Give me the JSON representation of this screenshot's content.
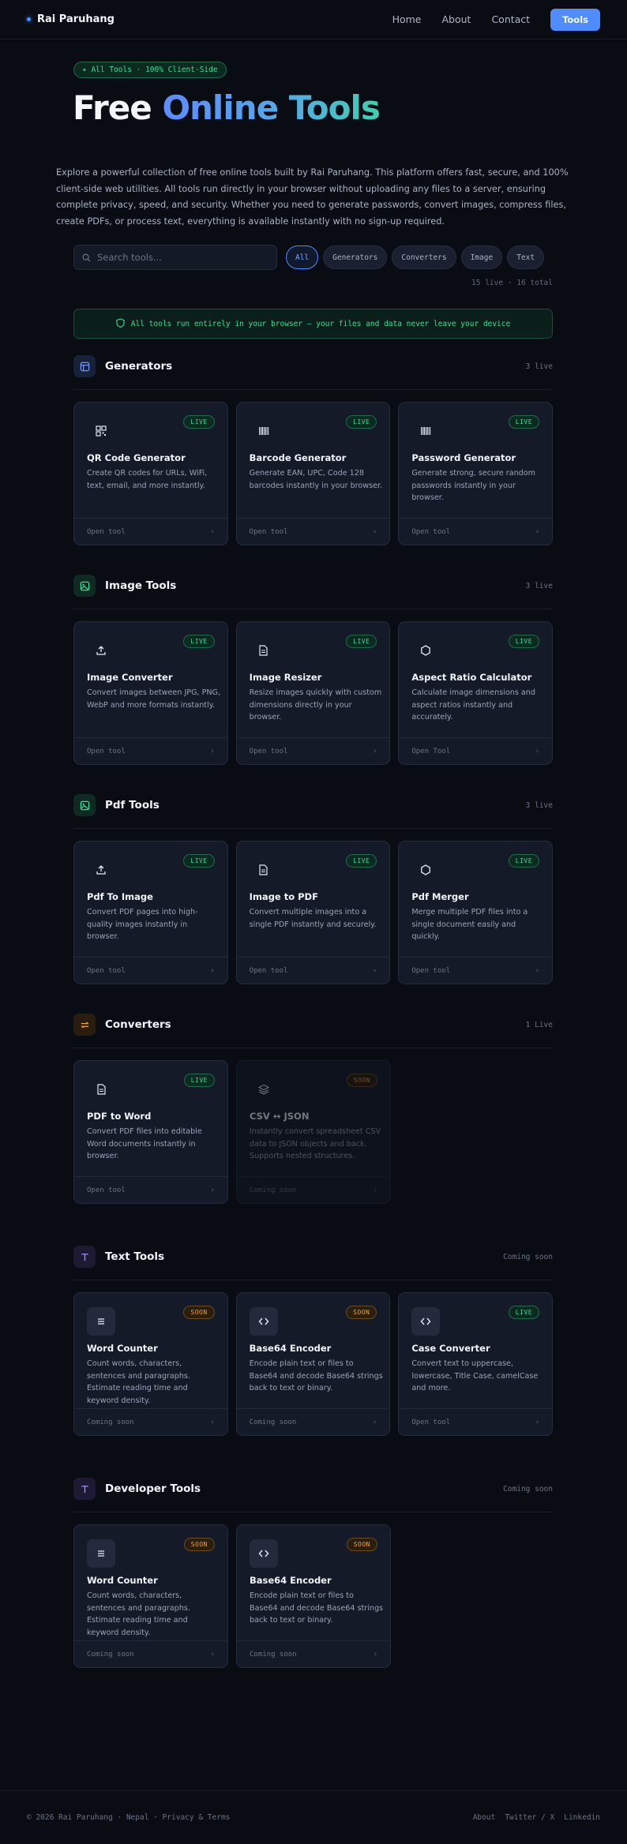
{
  "nav": {
    "brand": "Rai Paruhang",
    "links": [
      "Home",
      "About",
      "Contact"
    ],
    "cta": "Tools"
  },
  "hero": {
    "badge": "✦ All Tools · 100% Client-Side",
    "title_part1": "Free",
    "title_part2": "Online Tools",
    "description": "Explore a powerful collection of free online tools built by Rai Paruhang. This platform offers fast, secure, and 100% client-side web utilities. All tools run directly in your browser without uploading any files to a server, ensuring complete privacy, speed, and security. Whether you need to generate passwords, convert images, compress files, create PDFs, or process text, everything is available instantly with no sign-up required."
  },
  "search": {
    "placeholder": "Search tools..."
  },
  "filters": [
    "All",
    "Generators",
    "Converters",
    "Image",
    "Text"
  ],
  "counts": "15 live · 16 total",
  "notice": "All tools run entirely in your browser — your files and data never leave your device",
  "colors": {
    "accent": "#4f8cff",
    "live": "#3ddc97",
    "soon": "#f0a040"
  },
  "sections": [
    {
      "title": "Generators",
      "count": "3 live",
      "icon": "layout-icon",
      "cards": [
        {
          "icon": "qr-icon",
          "status": "LIVE",
          "title": "QR Code Generator",
          "desc": "Create QR codes for URLs, WiFi, text, email, and more instantly.",
          "footer": "Open tool"
        },
        {
          "icon": "barcode-icon",
          "status": "LIVE",
          "title": "Barcode Generator",
          "desc": "Generate EAN, UPC, Code 128 barcodes instantly in your browser.",
          "footer": "Open tool"
        },
        {
          "icon": "barcode-icon",
          "status": "LIVE",
          "title": "Password Generator",
          "desc": "Generate strong, secure random passwords instantly in your browser.",
          "footer": "Open tool"
        }
      ]
    },
    {
      "title": "Image Tools",
      "count": "3 live",
      "icon": "image-icon",
      "cards": [
        {
          "icon": "upload-icon",
          "status": "LIVE",
          "title": "Image Converter",
          "desc": "Convert images between JPG, PNG, WebP and more formats instantly.",
          "footer": "Open tool"
        },
        {
          "icon": "file-icon",
          "status": "LIVE",
          "title": "Image Resizer",
          "desc": "Resize images quickly with custom dimensions directly in your browser.",
          "footer": "Open tool"
        },
        {
          "icon": "hexagon-icon",
          "status": "LIVE",
          "title": "Aspect Ratio Calculator",
          "desc": "Calculate image dimensions and aspect ratios instantly and accurately.",
          "footer": "Open Tool"
        }
      ]
    },
    {
      "title": "Pdf Tools",
      "count": "3 live",
      "icon": "image-icon",
      "cards": [
        {
          "icon": "upload-icon",
          "status": "LIVE",
          "title": "Pdf To Image",
          "desc": "Convert PDF pages into high-quality images instantly in browser.",
          "footer": "Open tool"
        },
        {
          "icon": "file-icon",
          "status": "LIVE",
          "title": "Image to PDF",
          "desc": "Convert multiple images into a single PDF instantly and securely.",
          "footer": "Open tool"
        },
        {
          "icon": "hexagon-icon",
          "status": "LIVE",
          "title": "Pdf Merger",
          "desc": "Merge multiple PDF files into a single document easily and quickly.",
          "footer": "Open tool"
        }
      ]
    },
    {
      "title": "Converters",
      "count": "1 Live",
      "icon": "swap-icon",
      "cards": [
        {
          "icon": "file-icon",
          "status": "LIVE",
          "title": "PDF to Word",
          "desc": "Convert PDF files into editable Word documents instantly in browser.",
          "footer": "Open tool"
        },
        {
          "icon": "layers-icon",
          "status": "SOON",
          "title": "CSV ↔ JSON",
          "desc": "Instantly convert spreadsheet CSV data to JSON objects and back. Supports nested structures.",
          "footer": "Coming soon",
          "dim": true
        }
      ]
    },
    {
      "title": "Text Tools",
      "count": "Coming soon",
      "icon": "text-icon",
      "cards": [
        {
          "icon": "list-icon",
          "status": "SOON",
          "title": "Word Counter",
          "desc": "Count words, characters, sentences and paragraphs. Estimate reading time and keyword density.",
          "footer": "Coming soon",
          "boxed": true
        },
        {
          "icon": "code-icon",
          "status": "SOON",
          "title": "Base64 Encoder",
          "desc": "Encode plain text or files to Base64 and decode Base64 strings back to text or binary.",
          "footer": "Coming soon",
          "boxed": true
        },
        {
          "icon": "code-icon",
          "status": "LIVE",
          "title": "Case Converter",
          "desc": "Convert text to uppercase, lowercase, Title Case, camelCase and more.",
          "footer": "Open tool",
          "boxed": true
        }
      ]
    },
    {
      "title": "Developer Tools",
      "count": "Coming soon",
      "icon": "text-icon",
      "cards": [
        {
          "icon": "list-icon",
          "status": "SOON",
          "title": "Word Counter",
          "desc": "Count words, characters, sentences and paragraphs. Estimate reading time and keyword density.",
          "footer": "Coming soon",
          "boxed": true
        },
        {
          "icon": "code-icon",
          "status": "SOON",
          "title": "Base64 Encoder",
          "desc": "Encode plain text or files to Base64 and decode Base64 strings back to text or binary.",
          "footer": "Coming soon",
          "boxed": true
        }
      ]
    }
  ],
  "footer": {
    "left": "© 2026 Rai Paruhang · Nepal · Privacy & Terms",
    "links": [
      "About",
      "Twitter / X",
      "Linkedin"
    ]
  }
}
